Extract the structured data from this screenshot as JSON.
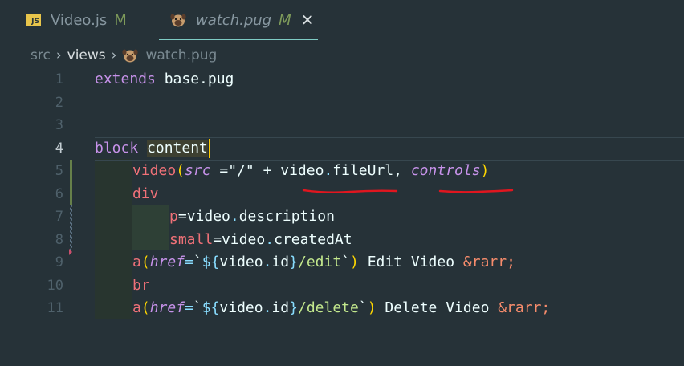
{
  "tabs": [
    {
      "icon": "js-icon",
      "icon_text": "JS",
      "label": "Video.js",
      "status": "M"
    },
    {
      "icon": "pug-icon",
      "label": "watch.pug",
      "status": "M",
      "close": "✕"
    }
  ],
  "breadcrumb": {
    "parts": [
      "src",
      "views",
      "watch.pug"
    ],
    "separator": "›"
  },
  "editor": {
    "line_numbers": [
      "1",
      "2",
      "3",
      "4",
      "5",
      "6",
      "7",
      "8",
      "9",
      "10",
      "11"
    ],
    "active_line": "4"
  },
  "code": {
    "l1": {
      "kw": "extends",
      "rest": " base.pug"
    },
    "l4": {
      "kw": "block",
      "word": "content"
    },
    "l5": {
      "tag": "video",
      "p1": "(",
      "attr1": "src",
      "t1": " =",
      "s1": "\"/\"",
      "t2": " + video",
      "dot": ".",
      "prop": "fileUrl",
      "t3": ", ",
      "attr2": "controls",
      "p2": ")"
    },
    "l6": {
      "tag": "div"
    },
    "l7": {
      "tag": "p",
      "eq": "=",
      "obj": "video",
      "dot": ".",
      "prop": "description"
    },
    "l8": {
      "tag": "small",
      "eq": "=",
      "obj": "video",
      "dot": ".",
      "prop": "createdAt"
    },
    "l9": {
      "tag": "a",
      "p1": "(",
      "attr": "href",
      "eq": "=",
      "bt": "`",
      "ip": "${",
      "obj": "video",
      "dot": ".",
      "prop": "id",
      "ic": "}",
      "s": "/edit",
      "bt2": "`",
      "p2": ")",
      "text": " Edit Video ",
      "ent": "&rarr;"
    },
    "l10": {
      "tag": "br"
    },
    "l11": {
      "tag": "a",
      "p1": "(",
      "attr": "href",
      "eq": "=",
      "bt": "`",
      "ip": "${",
      "obj": "video",
      "dot": ".",
      "prop": "id",
      "ic": "}",
      "s": "/delete",
      "bt2": "`",
      "p2": ")",
      "text": " Delete Video ",
      "ent": "&rarr;"
    }
  },
  "colors": {
    "background": "#263238",
    "keyword": "#c792ea",
    "tag": "#f07178",
    "string": "#c3e88d",
    "annotation": "#e0161f",
    "cursor": "#ffcc00"
  }
}
